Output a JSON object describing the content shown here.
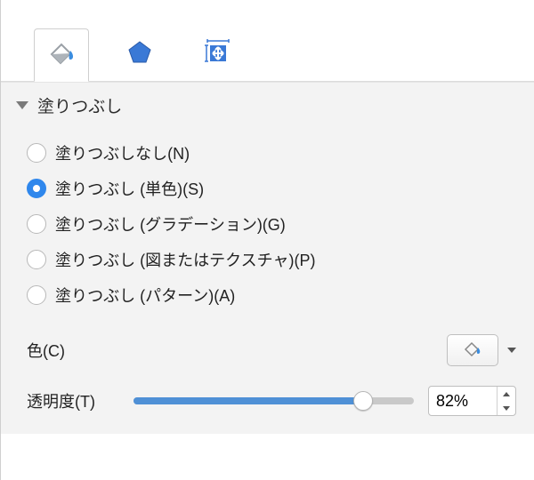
{
  "tabs": {
    "fill_tab": "塗りつぶし",
    "shape_tab": "図形",
    "size_tab": "サイズ"
  },
  "section": {
    "title": "塗りつぶし"
  },
  "fill_options": {
    "none": "塗りつぶしなし(N)",
    "solid": "塗りつぶし (単色)(S)",
    "gradient": "塗りつぶし (グラデーション)(G)",
    "picture": "塗りつぶし (図またはテクスチャ)(P)",
    "pattern": "塗りつぶし (パターン)(A)",
    "selected": "solid"
  },
  "color": {
    "label": "色(C)"
  },
  "transparency": {
    "label": "透明度(T)",
    "value": "82%",
    "percent": 82
  }
}
